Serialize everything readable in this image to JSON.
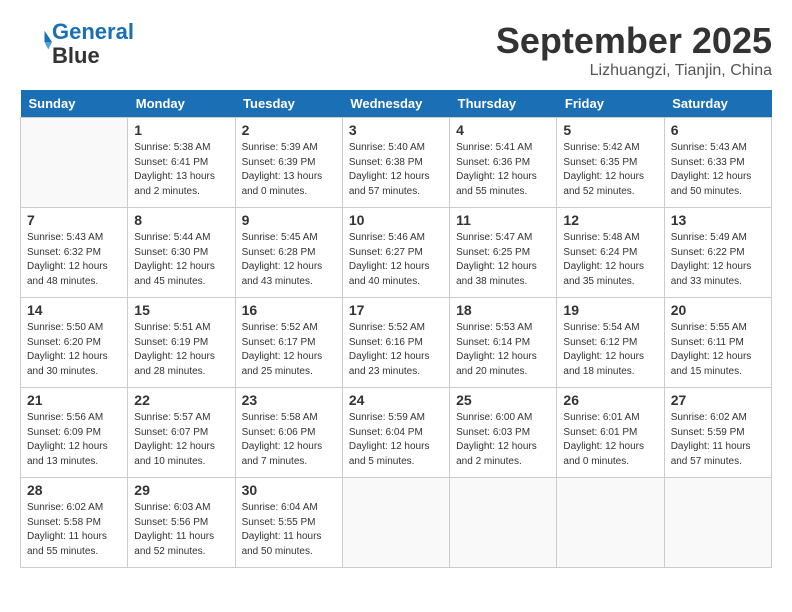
{
  "header": {
    "logo_line1": "General",
    "logo_line2": "Blue",
    "month": "September 2025",
    "location": "Lizhuangzi, Tianjin, China"
  },
  "days_of_week": [
    "Sunday",
    "Monday",
    "Tuesday",
    "Wednesday",
    "Thursday",
    "Friday",
    "Saturday"
  ],
  "weeks": [
    [
      {
        "day": "",
        "info": ""
      },
      {
        "day": "1",
        "info": "Sunrise: 5:38 AM\nSunset: 6:41 PM\nDaylight: 13 hours\nand 2 minutes."
      },
      {
        "day": "2",
        "info": "Sunrise: 5:39 AM\nSunset: 6:39 PM\nDaylight: 13 hours\nand 0 minutes."
      },
      {
        "day": "3",
        "info": "Sunrise: 5:40 AM\nSunset: 6:38 PM\nDaylight: 12 hours\nand 57 minutes."
      },
      {
        "day": "4",
        "info": "Sunrise: 5:41 AM\nSunset: 6:36 PM\nDaylight: 12 hours\nand 55 minutes."
      },
      {
        "day": "5",
        "info": "Sunrise: 5:42 AM\nSunset: 6:35 PM\nDaylight: 12 hours\nand 52 minutes."
      },
      {
        "day": "6",
        "info": "Sunrise: 5:43 AM\nSunset: 6:33 PM\nDaylight: 12 hours\nand 50 minutes."
      }
    ],
    [
      {
        "day": "7",
        "info": "Sunrise: 5:43 AM\nSunset: 6:32 PM\nDaylight: 12 hours\nand 48 minutes."
      },
      {
        "day": "8",
        "info": "Sunrise: 5:44 AM\nSunset: 6:30 PM\nDaylight: 12 hours\nand 45 minutes."
      },
      {
        "day": "9",
        "info": "Sunrise: 5:45 AM\nSunset: 6:28 PM\nDaylight: 12 hours\nand 43 minutes."
      },
      {
        "day": "10",
        "info": "Sunrise: 5:46 AM\nSunset: 6:27 PM\nDaylight: 12 hours\nand 40 minutes."
      },
      {
        "day": "11",
        "info": "Sunrise: 5:47 AM\nSunset: 6:25 PM\nDaylight: 12 hours\nand 38 minutes."
      },
      {
        "day": "12",
        "info": "Sunrise: 5:48 AM\nSunset: 6:24 PM\nDaylight: 12 hours\nand 35 minutes."
      },
      {
        "day": "13",
        "info": "Sunrise: 5:49 AM\nSunset: 6:22 PM\nDaylight: 12 hours\nand 33 minutes."
      }
    ],
    [
      {
        "day": "14",
        "info": "Sunrise: 5:50 AM\nSunset: 6:20 PM\nDaylight: 12 hours\nand 30 minutes."
      },
      {
        "day": "15",
        "info": "Sunrise: 5:51 AM\nSunset: 6:19 PM\nDaylight: 12 hours\nand 28 minutes."
      },
      {
        "day": "16",
        "info": "Sunrise: 5:52 AM\nSunset: 6:17 PM\nDaylight: 12 hours\nand 25 minutes."
      },
      {
        "day": "17",
        "info": "Sunrise: 5:52 AM\nSunset: 6:16 PM\nDaylight: 12 hours\nand 23 minutes."
      },
      {
        "day": "18",
        "info": "Sunrise: 5:53 AM\nSunset: 6:14 PM\nDaylight: 12 hours\nand 20 minutes."
      },
      {
        "day": "19",
        "info": "Sunrise: 5:54 AM\nSunset: 6:12 PM\nDaylight: 12 hours\nand 18 minutes."
      },
      {
        "day": "20",
        "info": "Sunrise: 5:55 AM\nSunset: 6:11 PM\nDaylight: 12 hours\nand 15 minutes."
      }
    ],
    [
      {
        "day": "21",
        "info": "Sunrise: 5:56 AM\nSunset: 6:09 PM\nDaylight: 12 hours\nand 13 minutes."
      },
      {
        "day": "22",
        "info": "Sunrise: 5:57 AM\nSunset: 6:07 PM\nDaylight: 12 hours\nand 10 minutes."
      },
      {
        "day": "23",
        "info": "Sunrise: 5:58 AM\nSunset: 6:06 PM\nDaylight: 12 hours\nand 7 minutes."
      },
      {
        "day": "24",
        "info": "Sunrise: 5:59 AM\nSunset: 6:04 PM\nDaylight: 12 hours\nand 5 minutes."
      },
      {
        "day": "25",
        "info": "Sunrise: 6:00 AM\nSunset: 6:03 PM\nDaylight: 12 hours\nand 2 minutes."
      },
      {
        "day": "26",
        "info": "Sunrise: 6:01 AM\nSunset: 6:01 PM\nDaylight: 12 hours\nand 0 minutes."
      },
      {
        "day": "27",
        "info": "Sunrise: 6:02 AM\nSunset: 5:59 PM\nDaylight: 11 hours\nand 57 minutes."
      }
    ],
    [
      {
        "day": "28",
        "info": "Sunrise: 6:02 AM\nSunset: 5:58 PM\nDaylight: 11 hours\nand 55 minutes."
      },
      {
        "day": "29",
        "info": "Sunrise: 6:03 AM\nSunset: 5:56 PM\nDaylight: 11 hours\nand 52 minutes."
      },
      {
        "day": "30",
        "info": "Sunrise: 6:04 AM\nSunset: 5:55 PM\nDaylight: 11 hours\nand 50 minutes."
      },
      {
        "day": "",
        "info": ""
      },
      {
        "day": "",
        "info": ""
      },
      {
        "day": "",
        "info": ""
      },
      {
        "day": "",
        "info": ""
      }
    ]
  ]
}
